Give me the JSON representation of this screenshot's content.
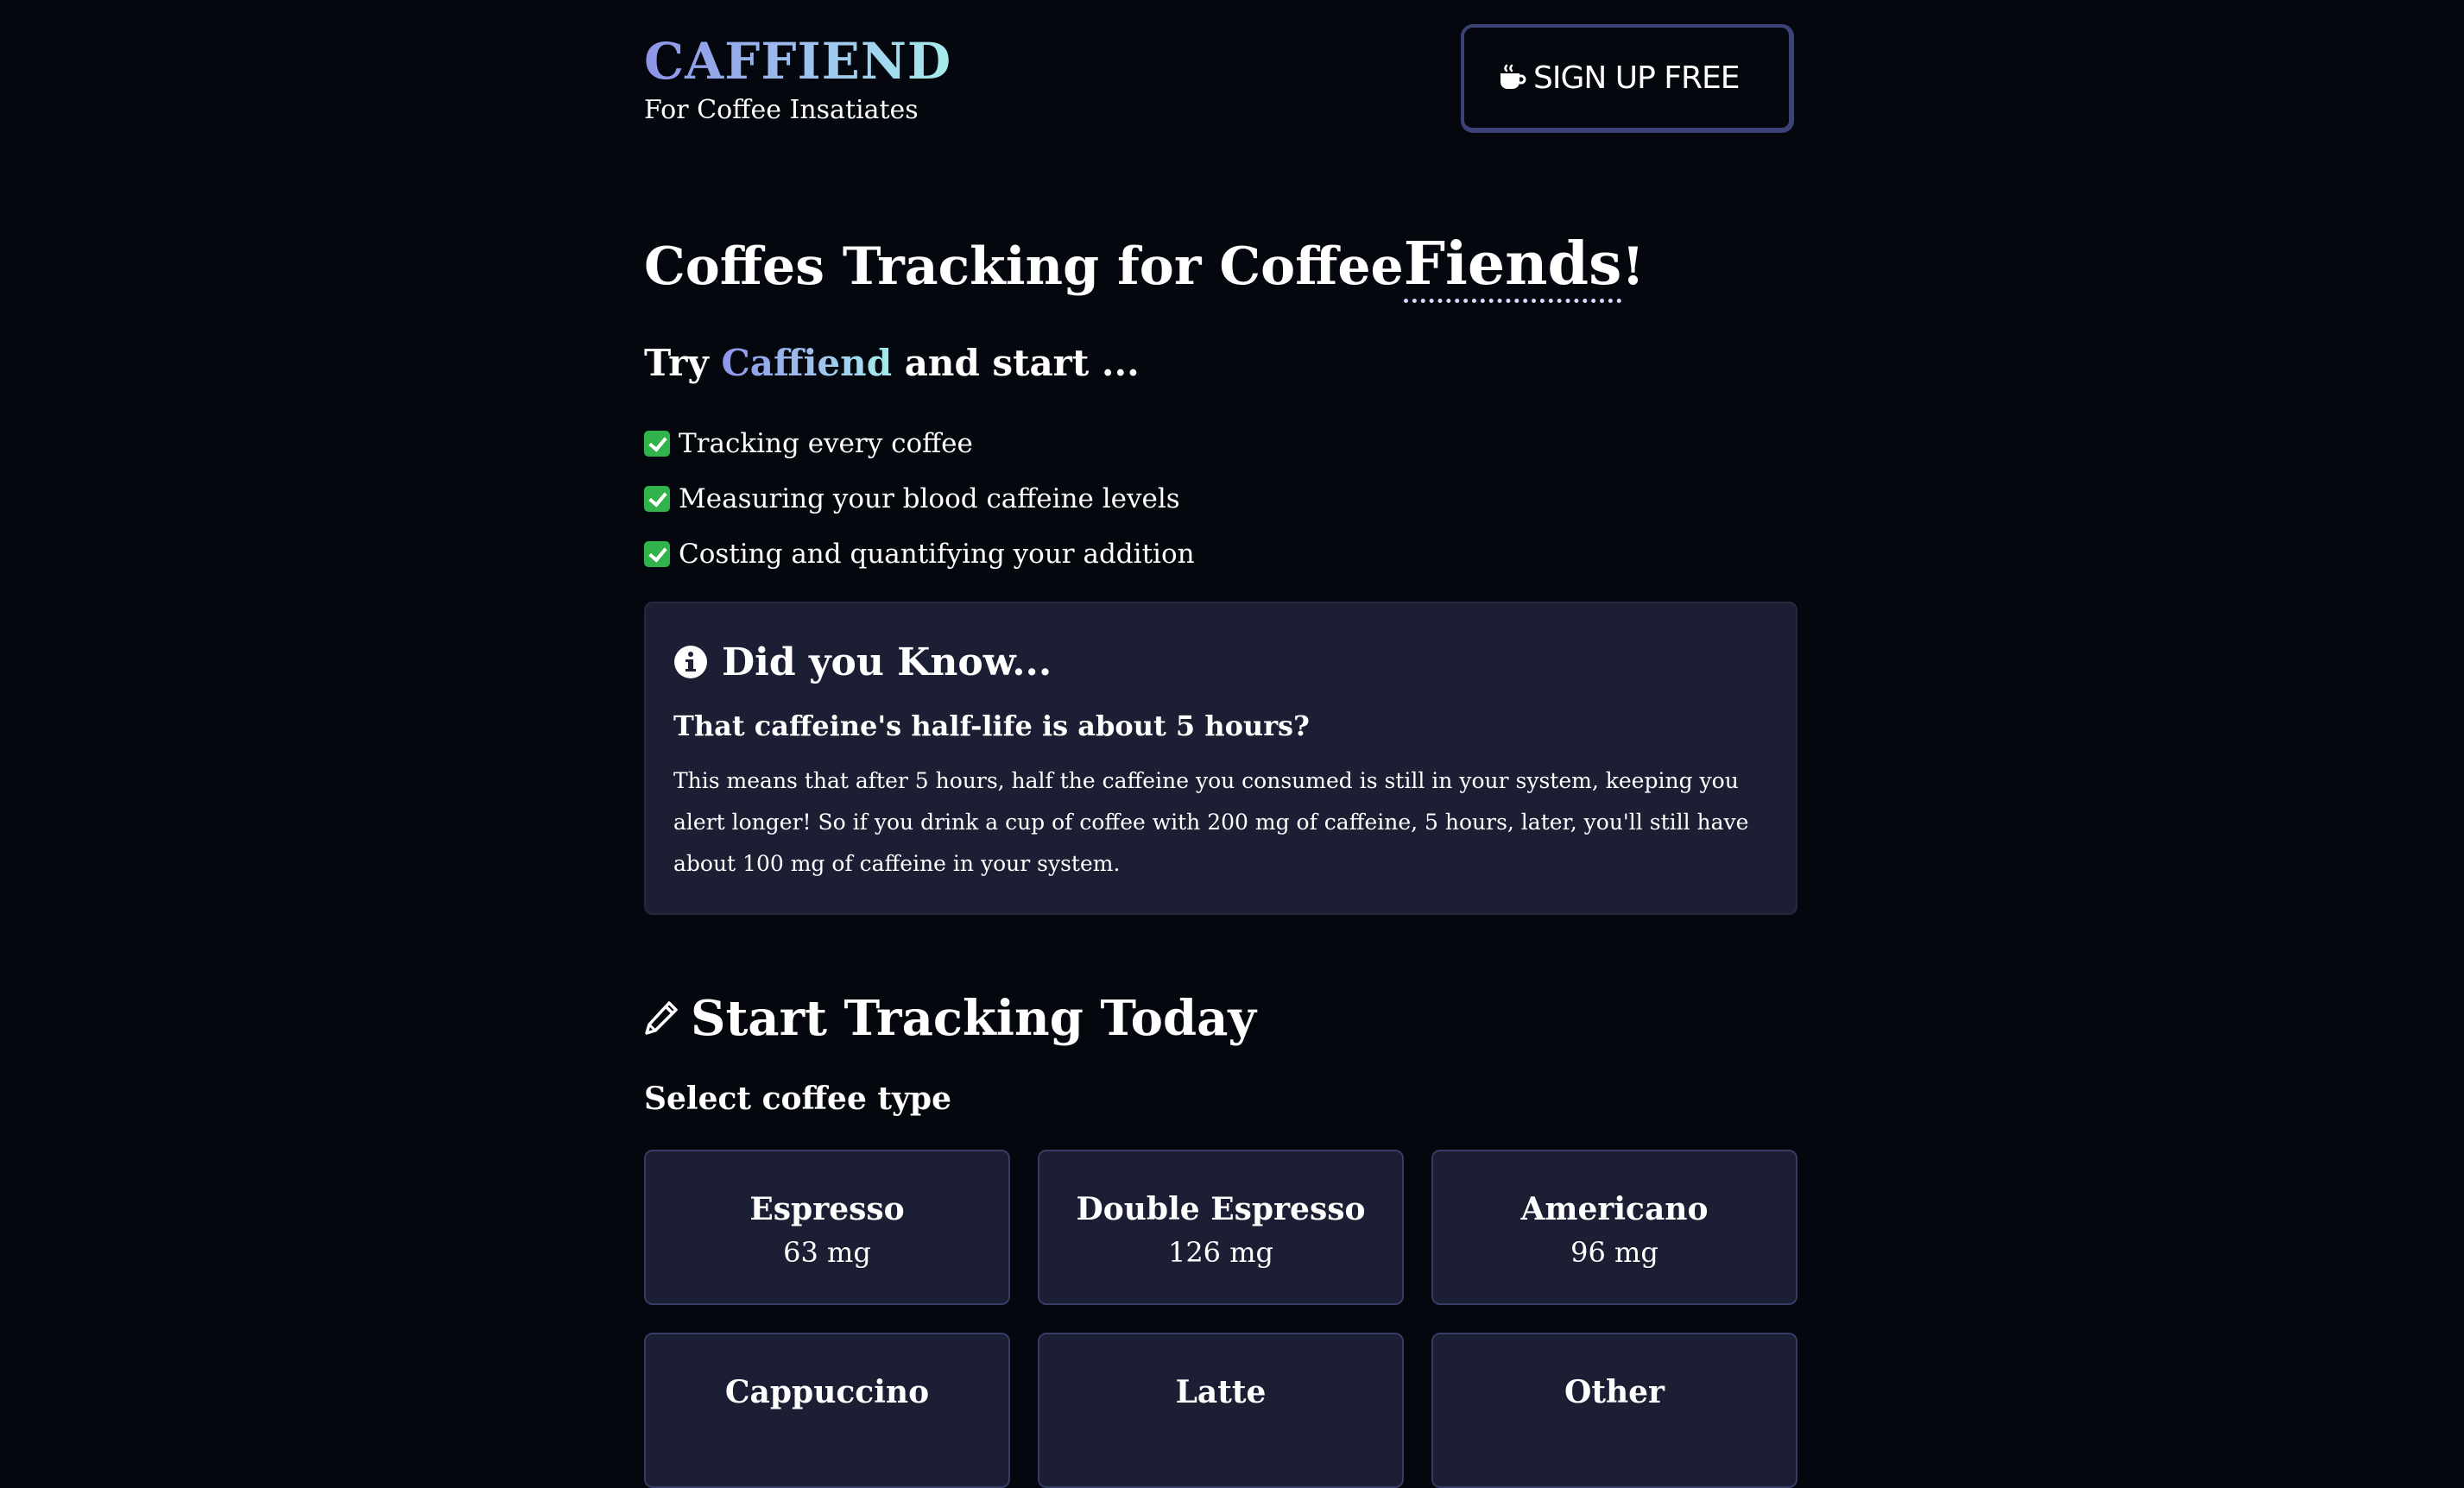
{
  "header": {
    "brand": "CAFFIEND",
    "tagline": "For Coffee Insatiates",
    "signup_label": "SIGN UP FREE",
    "signup_icon": "coffee-cup-icon"
  },
  "hero": {
    "title_prefix": "Coffes Tracking for Coffee",
    "title_emphasis": "Fiends",
    "title_suffix": "!",
    "subtitle_prefix": "Try",
    "subtitle_brand": "Caffiend",
    "subtitle_suffix": "and start ...",
    "features": [
      "Tracking every coffee",
      "Measuring your blood caffeine levels",
      "Costing and quantifying your addition"
    ],
    "feature_icon": "check-mark-icon"
  },
  "did_you_know": {
    "icon": "info-icon",
    "title": "Did you Know...",
    "question": "That caffeine's half-life is about 5 hours?",
    "body": "This means that after 5 hours, half the caffeine you consumed is still in your system, keeping you alert longer! So if you drink a cup of coffee with 200 mg of caffeine, 5 hours, later, you'll still have about 100 mg of caffeine in your system."
  },
  "tracking": {
    "icon": "pencil-icon",
    "title": "Start Tracking Today",
    "select_label": "Select coffee type",
    "coffee_types": [
      {
        "name": "Espresso",
        "caffeine": "63 mg"
      },
      {
        "name": "Double Espresso",
        "caffeine": "126 mg"
      },
      {
        "name": "Americano",
        "caffeine": "96 mg"
      },
      {
        "name": "Cappuccino",
        "caffeine": ""
      },
      {
        "name": "Latte",
        "caffeine": ""
      },
      {
        "name": "Other",
        "caffeine": ""
      }
    ]
  },
  "colors": {
    "background": "#05070e",
    "panel": "#1c1f33",
    "border": "#363c63",
    "brand_gradient_start": "#8d94e8",
    "brand_gradient_end": "#a6ecec",
    "check_green": "#2fb34a"
  }
}
